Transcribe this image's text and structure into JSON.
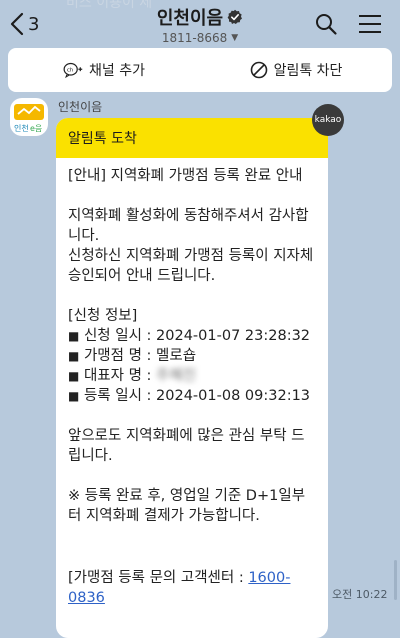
{
  "header": {
    "ghost_text": "비스 이용이 제",
    "back_count": "3",
    "title": "인천이음",
    "phone": "1811-8668"
  },
  "actions": {
    "add_channel": "채널 추가",
    "block_alimtalk": "알림톡 차단"
  },
  "message": {
    "sender": "인천이음",
    "badge": "kakao",
    "header": "알림톡 도착",
    "title_line": "[안내] 지역화폐 가맹점 등록 완료 안내",
    "thanks": "지역화폐 활성화에 동참해주셔서 감사합니다.",
    "approved": "신청하신 지역화폐 가맹점 등록이 지자체 승인되어 안내 드립니다.",
    "info_header": "[신청 정보]",
    "info": [
      {
        "label": "신청 일시 : ",
        "value": "2024-01-07 23:28:32"
      },
      {
        "label": "가맹점 명 : ",
        "value": "멜로숍"
      },
      {
        "label": "대표자 명 : ",
        "value": "주혜진"
      },
      {
        "label": "등록 일시 : ",
        "value": "2024-01-08 09:32:13"
      }
    ],
    "request": "앞으로도 지역화폐에 많은 관심 부탁 드립니다.",
    "note": "※ 등록 완료 후, 영업일 기준 D+1일부터 지역화폐 결제가 가능합니다.",
    "contact_prefix": "[가맹점 등록 문의 고객센터 : ",
    "contact_number": "1600-0836",
    "time": "오전 10:22"
  },
  "avatar_text": {
    "line1": "인천",
    "line2": "e음"
  },
  "colors": {
    "background": "#b7c9dc",
    "header_yellow": "#fae100",
    "link": "#2e62c7"
  }
}
